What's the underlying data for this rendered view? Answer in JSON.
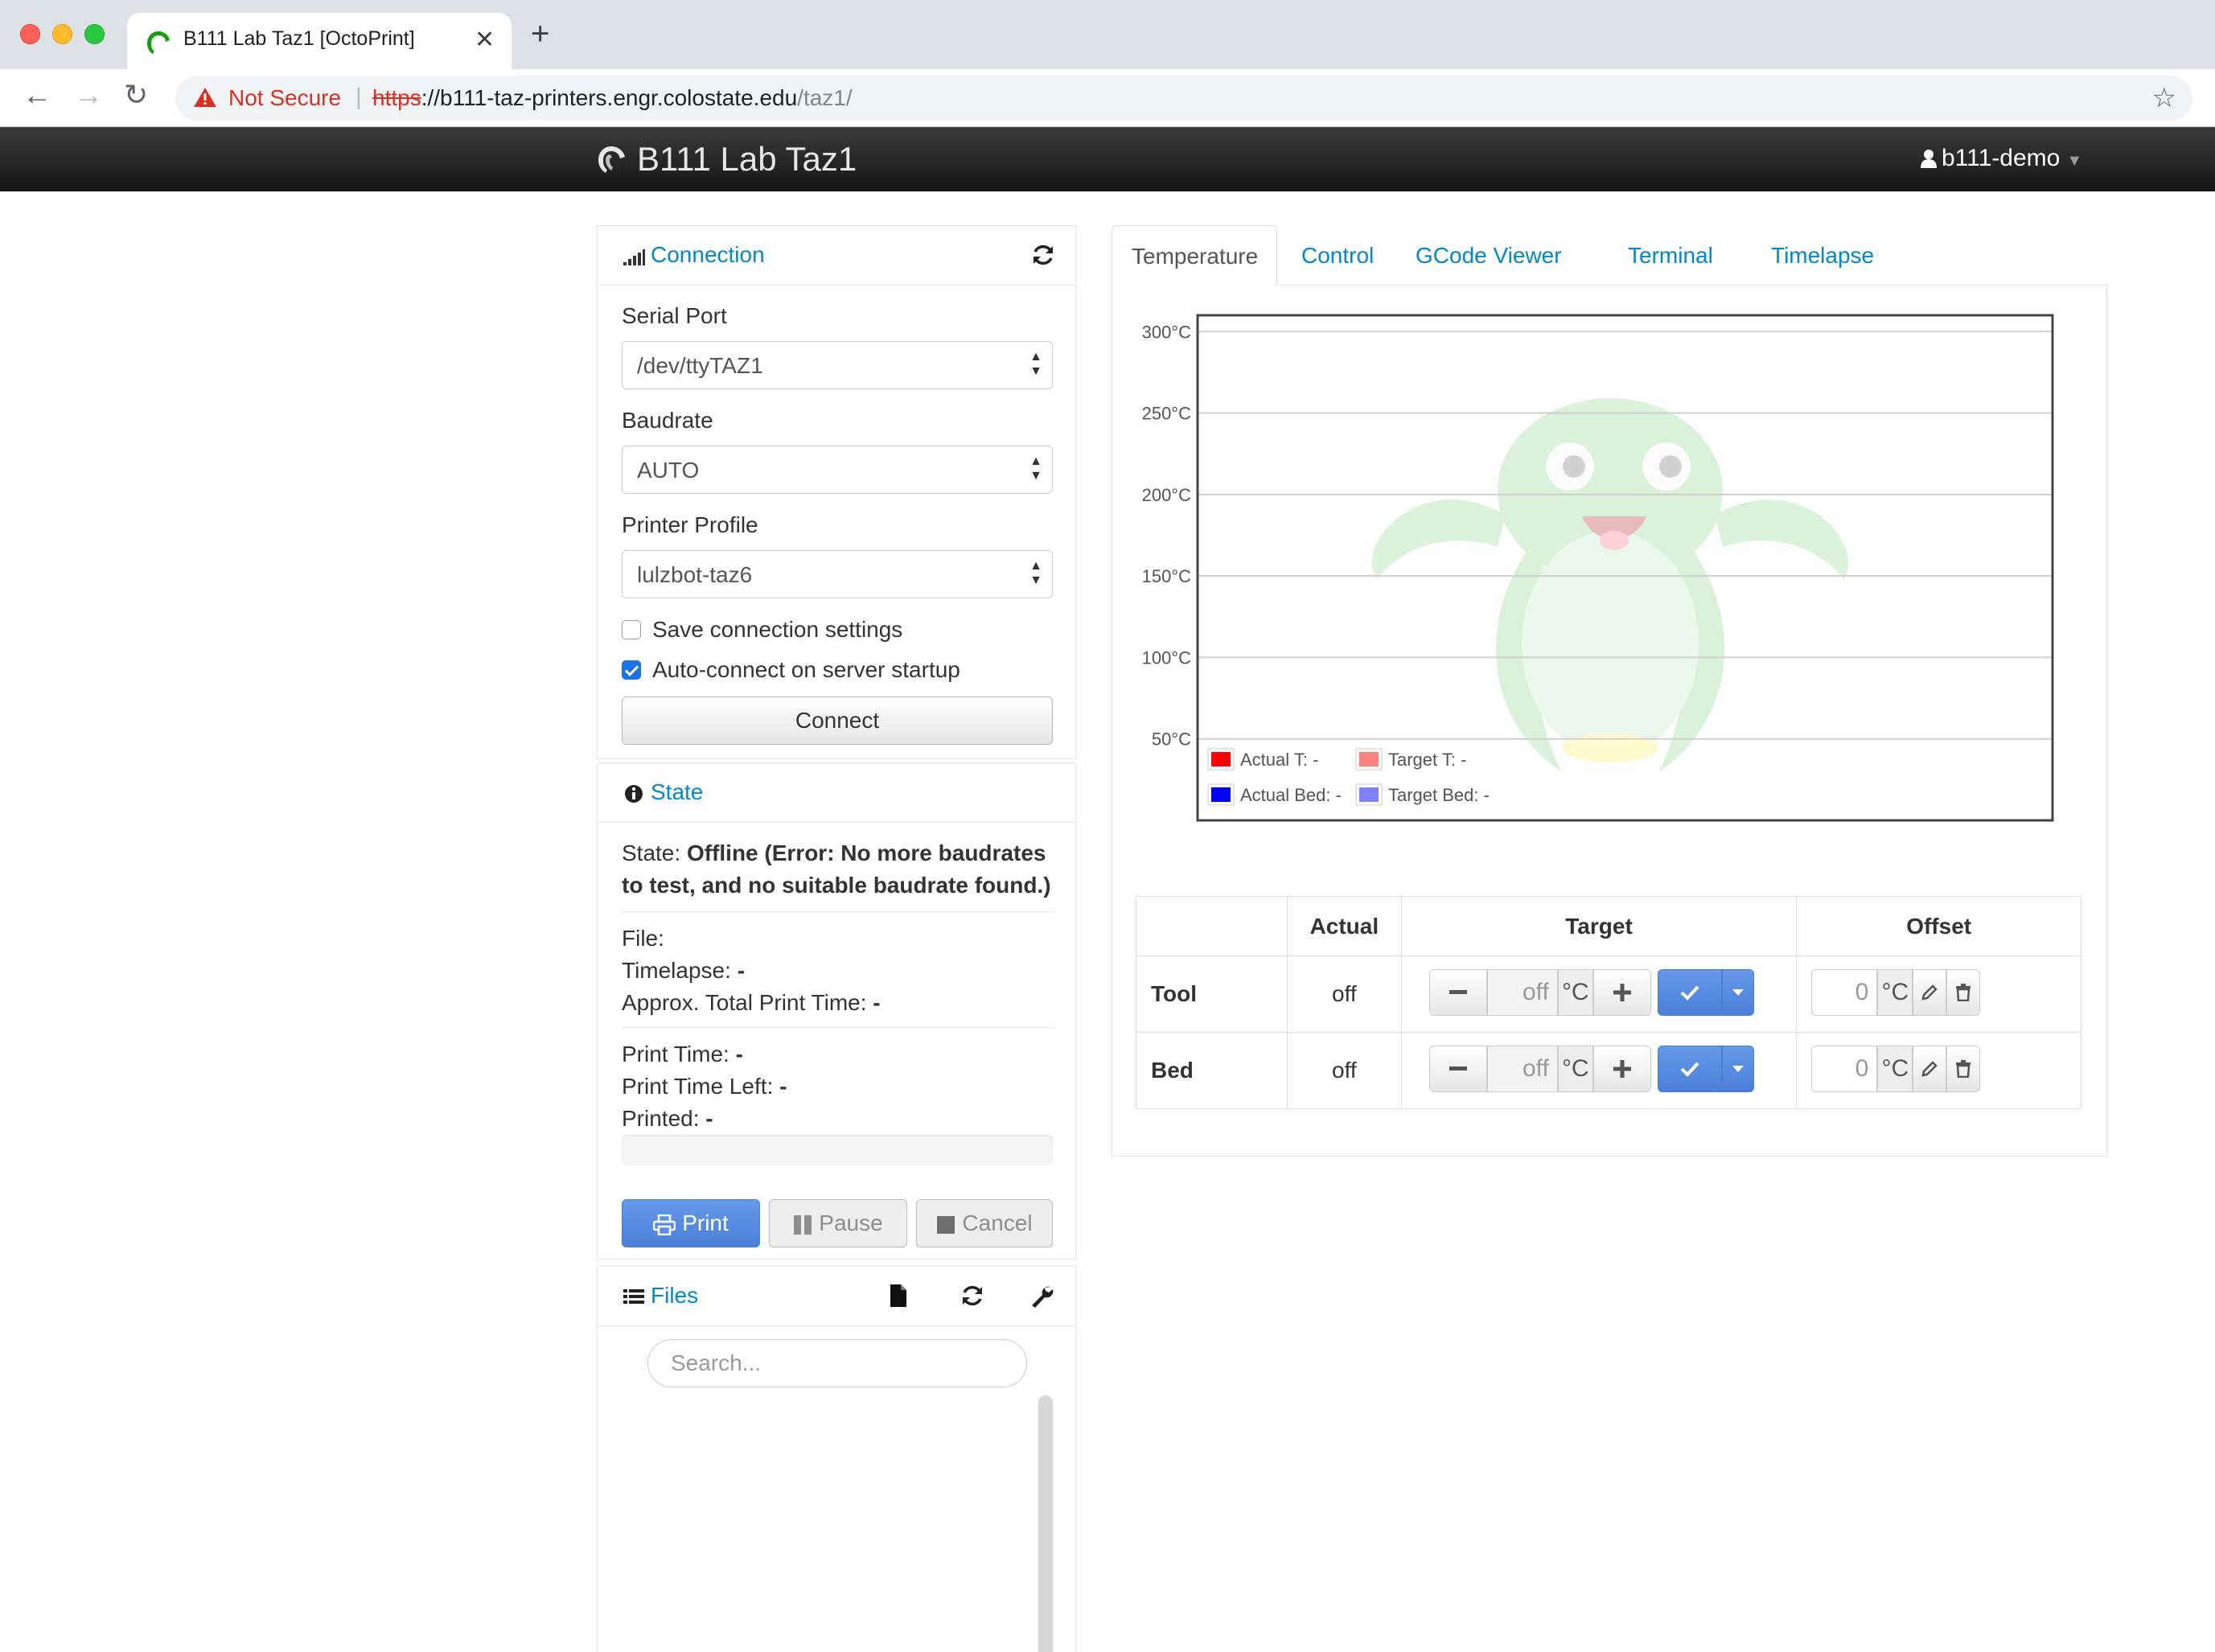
{
  "browser": {
    "tab_title": "B111 Lab Taz1 [OctoPrint]",
    "new_tab": "+",
    "security_label": "Not Secure",
    "url_scheme": "https",
    "url_host": "://b111-taz-printers.engr.colostate.edu",
    "url_path": "/taz1/"
  },
  "navbar": {
    "brand": "B111 Lab Taz1",
    "user": "b111-demo"
  },
  "connection": {
    "title": "Connection",
    "serial_port_label": "Serial Port",
    "serial_port_value": "/dev/ttyTAZ1",
    "baudrate_label": "Baudrate",
    "baudrate_value": "AUTO",
    "profile_label": "Printer Profile",
    "profile_value": "lulzbot-taz6",
    "save_settings_label": "Save connection settings",
    "save_settings_checked": false,
    "autoconnect_label": "Auto-connect on server startup",
    "autoconnect_checked": true,
    "connect_button": "Connect"
  },
  "state": {
    "title": "State",
    "state_label": "State:",
    "state_value_1": "Offline (Error: No more baudrates",
    "state_value_2": "to test, and no suitable baudrate found.)",
    "file_label": "File:",
    "timelapse_label": "Timelapse:",
    "timelapse_value": "-",
    "approx_label": "Approx. Total Print Time:",
    "approx_value": "-",
    "print_time_label": "Print Time:",
    "print_time_value": "-",
    "time_left_label": "Print Time Left:",
    "time_left_value": "-",
    "printed_label": "Printed:",
    "printed_value": "-",
    "progress": 0,
    "print_button": "Print",
    "pause_button": "Pause",
    "cancel_button": "Cancel"
  },
  "files": {
    "title": "Files",
    "search_placeholder": "Search..."
  },
  "tabs": [
    "Temperature",
    "Control",
    "GCode Viewer",
    "Terminal",
    "Timelapse"
  ],
  "chart_data": {
    "type": "line",
    "yticks": [
      "300°C",
      "250°C",
      "200°C",
      "150°C",
      "100°C",
      "50°C"
    ],
    "ylim": [
      0,
      310
    ],
    "grid": true,
    "legend_position": "bottom-left",
    "series": [
      {
        "name": "Actual T: -",
        "color": "#ff0000",
        "values": []
      },
      {
        "name": "Target T: -",
        "color": "#ff8080",
        "values": []
      },
      {
        "name": "Actual Bed: -",
        "color": "#0000ff",
        "values": []
      },
      {
        "name": "Target Bed: -",
        "color": "#8080ff",
        "values": []
      }
    ]
  },
  "temperature_table": {
    "headers": [
      "",
      "Actual",
      "Target",
      "Offset"
    ],
    "unit": "°C",
    "rows": [
      {
        "name": "Tool",
        "actual": "off",
        "target": "off",
        "offset": "0"
      },
      {
        "name": "Bed",
        "actual": "off",
        "target": "off",
        "offset": "0"
      }
    ]
  },
  "colors": {
    "link": "#0088cc",
    "primary_button": "#5a8de0",
    "navbar": "#222222",
    "error": "#d93025"
  }
}
